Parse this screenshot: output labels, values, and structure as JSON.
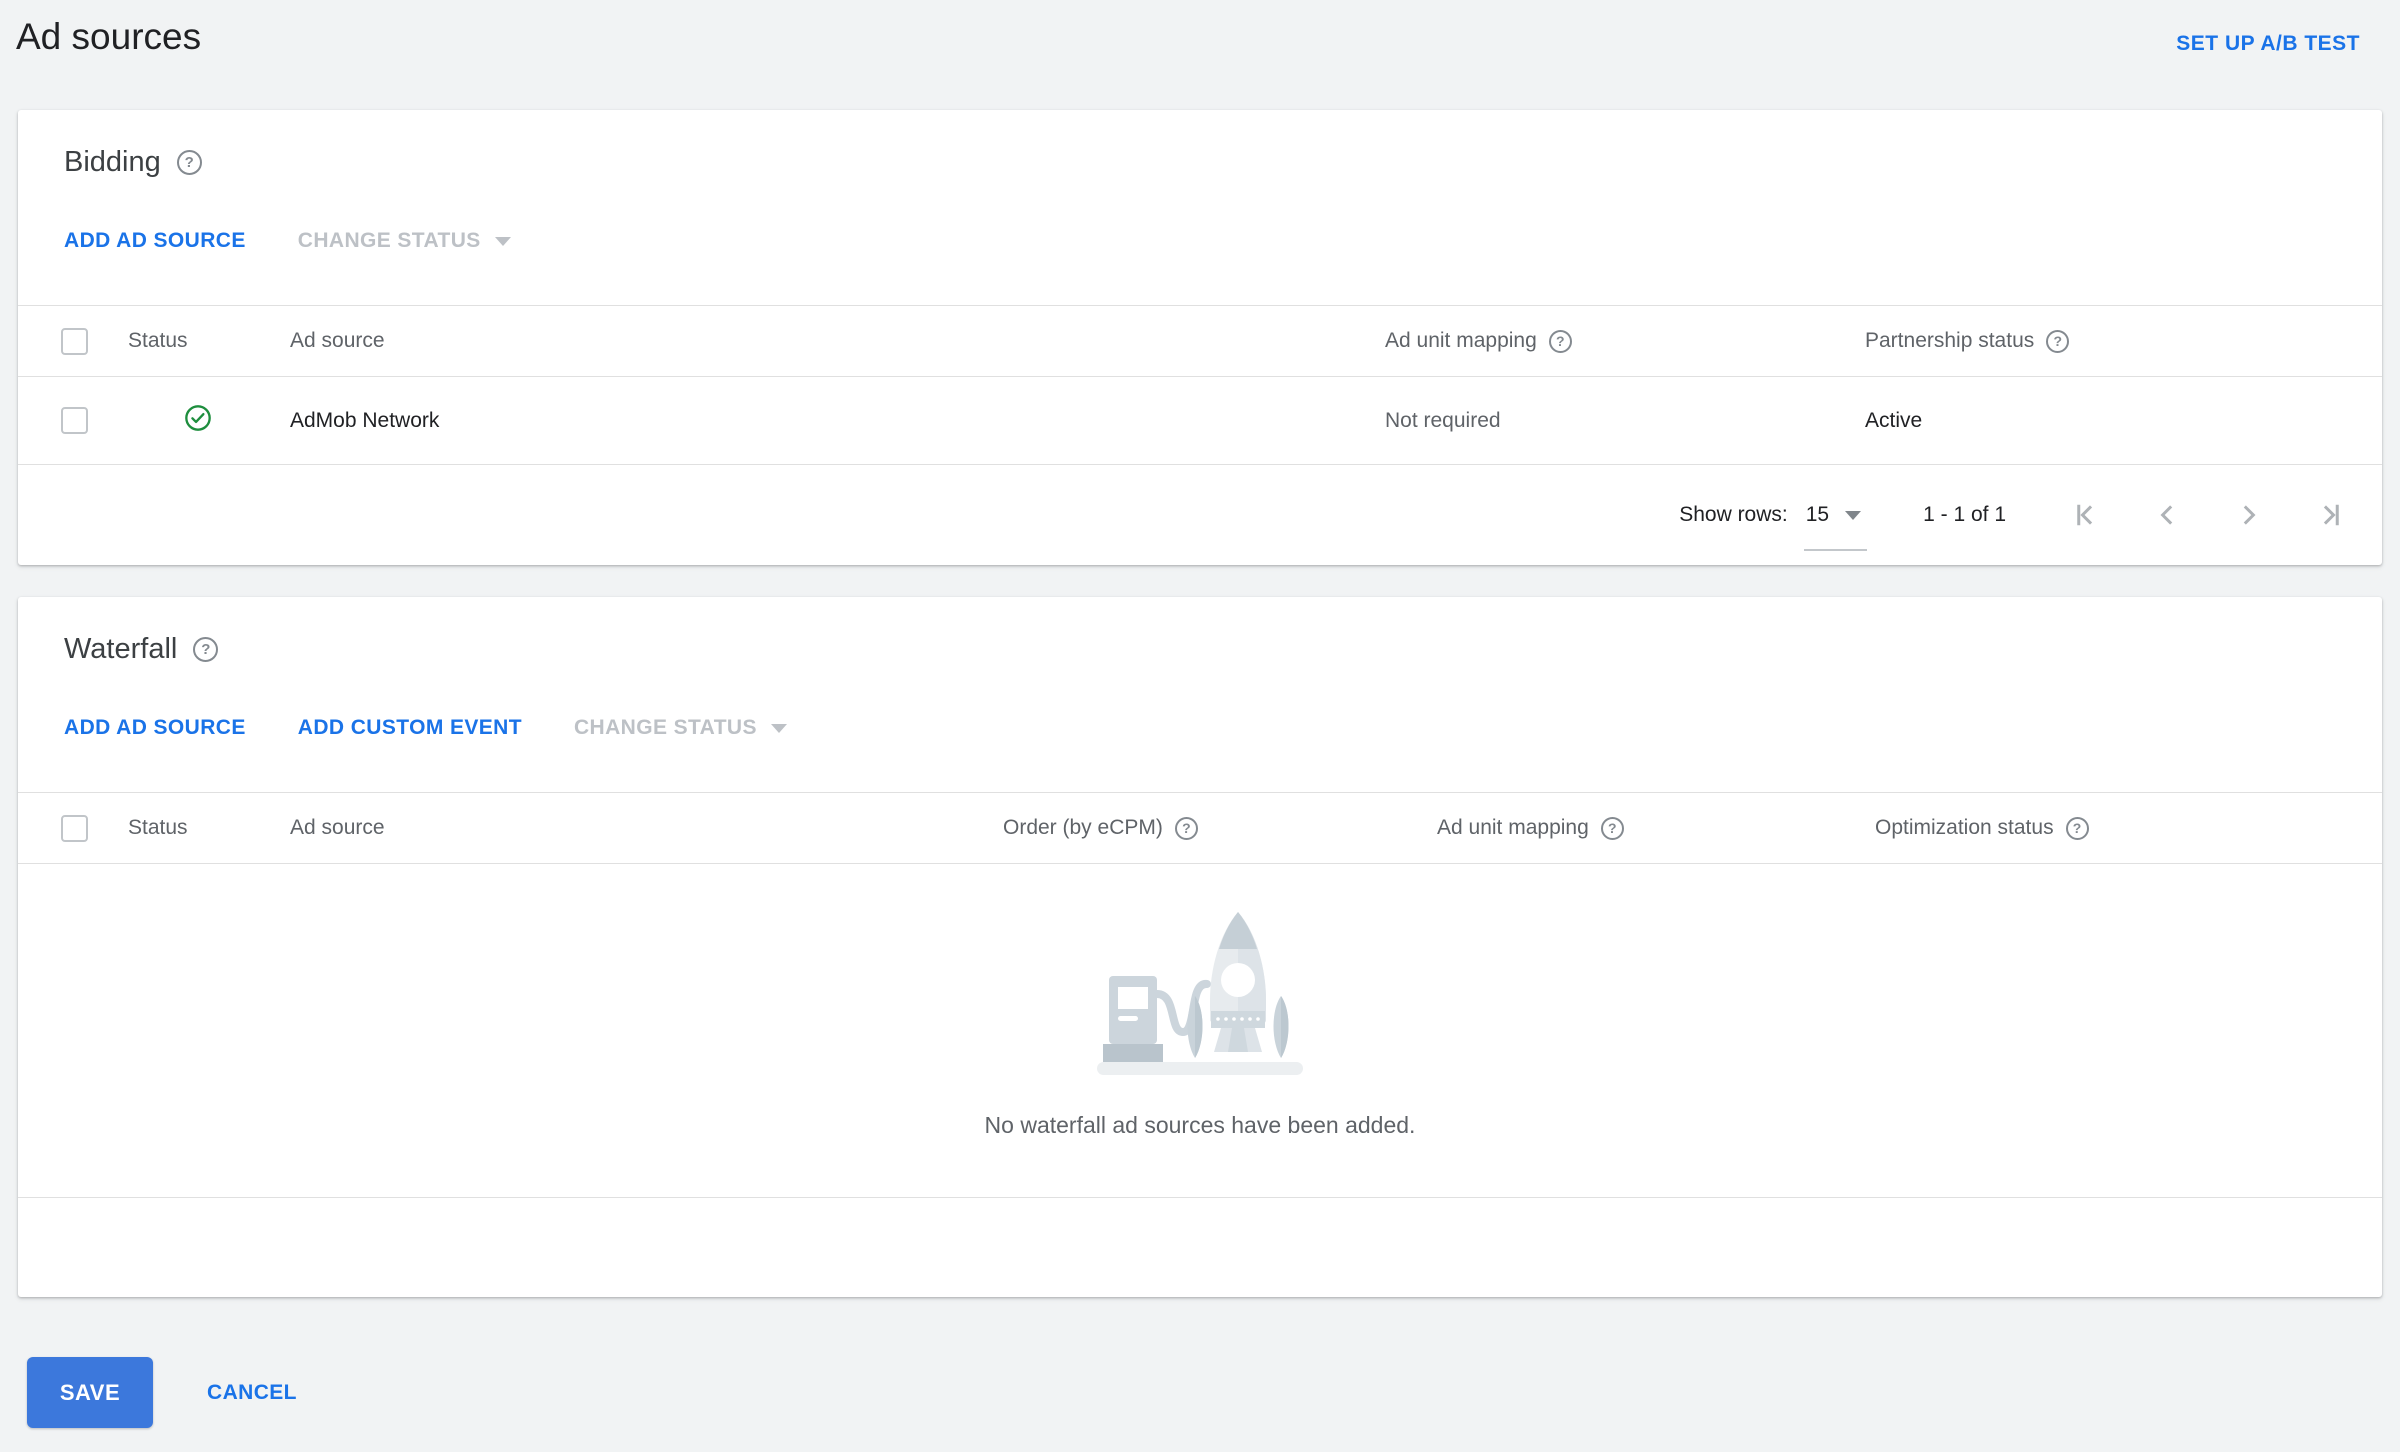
{
  "help_glyph": "?",
  "page": {
    "title": "Ad sources",
    "setup_ab_test_label": "SET UP A/B TEST"
  },
  "bidding": {
    "title": "Bidding",
    "actions": {
      "add_ad_source": "ADD AD SOURCE",
      "change_status": "CHANGE STATUS"
    },
    "columns": {
      "status": "Status",
      "ad_source": "Ad source",
      "ad_unit_mapping": "Ad unit mapping",
      "partnership_status": "Partnership status"
    },
    "rows": [
      {
        "status_icon": "check-circle",
        "ad_source": "AdMob Network",
        "ad_unit_mapping": "Not required",
        "partnership_status": "Active"
      }
    ],
    "pagination": {
      "show_rows_label": "Show rows:",
      "rows_per_page": "15",
      "range": "1 - 1 of 1"
    }
  },
  "waterfall": {
    "title": "Waterfall",
    "actions": {
      "add_ad_source": "ADD AD SOURCE",
      "add_custom_event": "ADD CUSTOM EVENT",
      "change_status": "CHANGE STATUS"
    },
    "columns": {
      "status": "Status",
      "ad_source": "Ad source",
      "order_by_ecpm": "Order (by eCPM)",
      "ad_unit_mapping": "Ad unit mapping",
      "optimization_status": "Optimization status"
    },
    "empty_message": "No waterfall ad sources have been added."
  },
  "footer": {
    "save_label": "SAVE",
    "cancel_label": "CANCEL"
  },
  "colors": {
    "link_blue": "#1a73e8",
    "save_blue": "#3c78dc",
    "status_green": "#1e8e3e",
    "disabled_gray": "#bdc1c6",
    "page_bg": "#f1f3f4"
  }
}
